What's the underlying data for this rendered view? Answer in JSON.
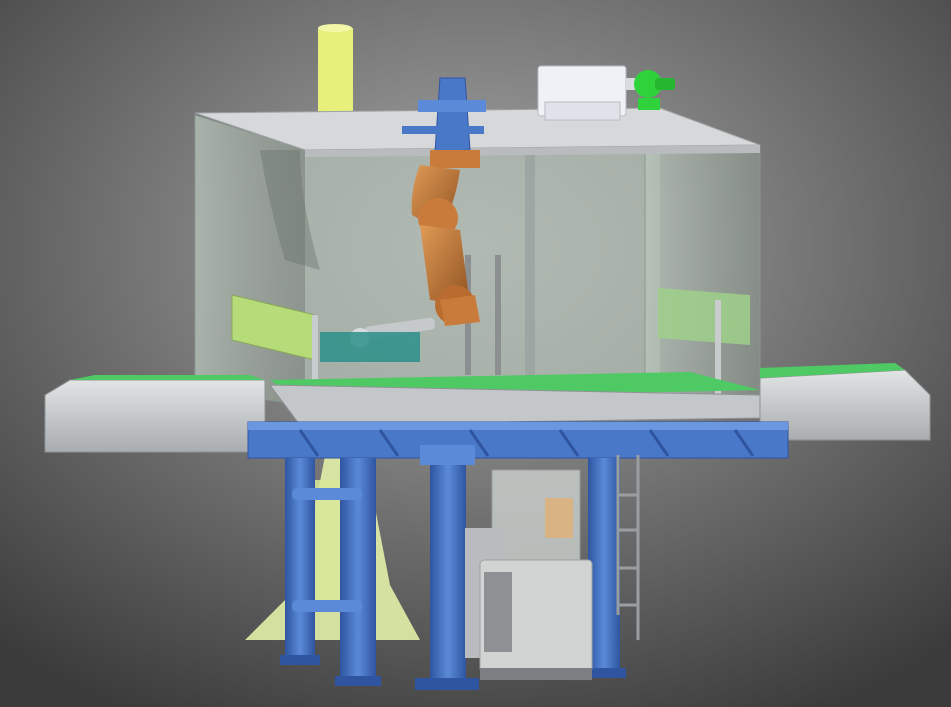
{
  "scene": {
    "subject": "robotic-cell-cad-render",
    "colors": {
      "background_light": "#a9a9a9",
      "background_dark": "#3b3b3b",
      "frame_blue": "#4a78c8",
      "frame_blue_dark": "#2f55a0",
      "robot_orange": "#c97b3b",
      "robot_orange_dark": "#8f5222",
      "conveyor_green": "#4fc964",
      "enclosure_grey": "#c9cdd0",
      "roof_grey": "#d6d8d9",
      "glass": "#b7c4b9",
      "base_yellow": "#e2efa8",
      "chimney_yellow": "#e6f07a",
      "fan_green": "#2fd23a",
      "cabinet_grey": "#d2d4d4"
    }
  }
}
